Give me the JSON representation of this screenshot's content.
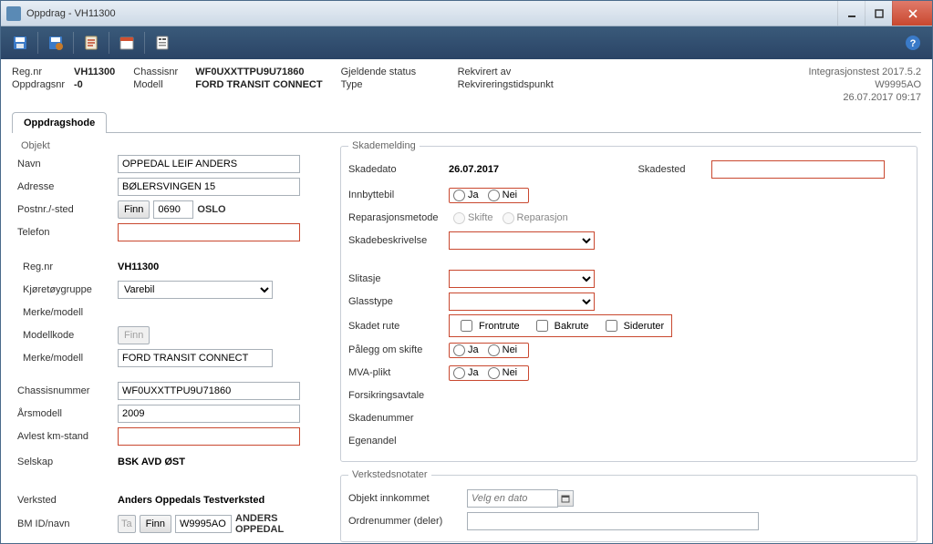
{
  "window": {
    "title": "Oppdrag - VH11300"
  },
  "toolbar": {
    "save": "save-icon",
    "save_special": "save-gear-icon",
    "clipboard": "clipboard-icon",
    "calendar": "calendar-icon",
    "form": "form-icon"
  },
  "header": {
    "regnr_label": "Reg.nr",
    "regnr": "VH11300",
    "oppdragsnr_label": "Oppdragsnr",
    "oppdragsnr": "-0",
    "chassisnr_label": "Chassisnr",
    "chassisnr": "WF0UXXTTPU9U71860",
    "modell_label": "Modell",
    "modell": "FORD TRANSIT CONNECT",
    "status_label": "Gjeldende status",
    "status": "",
    "type_label": "Type",
    "type": "",
    "rekvirert_label": "Rekvirert av",
    "rekvirert": "",
    "rekv_tid_label": "Rekvireringstidspunkt",
    "rekv_tid": "",
    "meta1": "Integrasjonstest 2017.5.2",
    "meta2": "W9995AO",
    "meta3": "26.07.2017 09:17"
  },
  "tabs": {
    "oppdragshode": "Oppdragshode"
  },
  "objekt": {
    "legend": "Objekt",
    "navn_label": "Navn",
    "navn_value": "OPPEDAL LEIF ANDERS",
    "adresse_label": "Adresse",
    "adresse_value": "BØLERSVINGEN 15",
    "postnr_label": "Postnr./-sted",
    "finn_btn": "Finn",
    "postnr_value": "0690",
    "poststed": "OSLO",
    "telefon_label": "Telefon",
    "telefon_value": "",
    "regnr_label": "Reg.nr",
    "regnr_value": "VH11300",
    "kjoretoy_label": "Kjøretøygruppe",
    "kjoretoy_value": "Varebil",
    "merke_label": "Merke/modell",
    "modellkode_label": "Modellkode",
    "modellkode_btn": "Finn",
    "merke2_label": "Merke/modell",
    "merke2_value": "FORD TRANSIT CONNECT",
    "chassis_label": "Chassisnummer",
    "chassis_value": "WF0UXXTTPU9U71860",
    "arsmodell_label": "Årsmodell",
    "arsmodell_value": "2009",
    "km_label": "Avlest km-stand",
    "km_value": "",
    "selskap_label": "Selskap",
    "selskap_value": "BSK AVD ØST",
    "verksted_label": "Verksted",
    "verksted_value": "Anders Oppedals Testverksted",
    "bm_label": "BM ID/navn",
    "ta_btn": "Ta",
    "bm_value": "W9995AO",
    "bm_name": "ANDERS OPPEDAL"
  },
  "skade": {
    "legend": "Skademelding",
    "skadedato_label": "Skadedato",
    "skadedato_value": "26.07.2017",
    "skadested_label": "Skadested",
    "skadested_value": "",
    "innbyttebil_label": "Innbyttebil",
    "ja": "Ja",
    "nei": "Nei",
    "repmetode_label": "Reparasjonsmetode",
    "skifte": "Skifte",
    "reparasjon": "Reparasjon",
    "skadebeskr_label": "Skadebeskrivelse",
    "slitasje_label": "Slitasje",
    "glasstype_label": "Glasstype",
    "skadetrute_label": "Skadet rute",
    "frontrute": "Frontrute",
    "bakrute": "Bakrute",
    "sideruter": "Sideruter",
    "palegg_label": "Pålegg om skifte",
    "mva_label": "MVA-plikt",
    "forsikring_label": "Forsikringsavtale",
    "skadenr_label": "Skadenummer",
    "egenandel_label": "Egenandel"
  },
  "notater": {
    "legend": "Verkstedsnotater",
    "objekt_innkommet_label": "Objekt innkommet",
    "dato_placeholder": "Velg en dato",
    "ordrenr_label": "Ordrenummer (deler)",
    "ordrenr_value": ""
  }
}
